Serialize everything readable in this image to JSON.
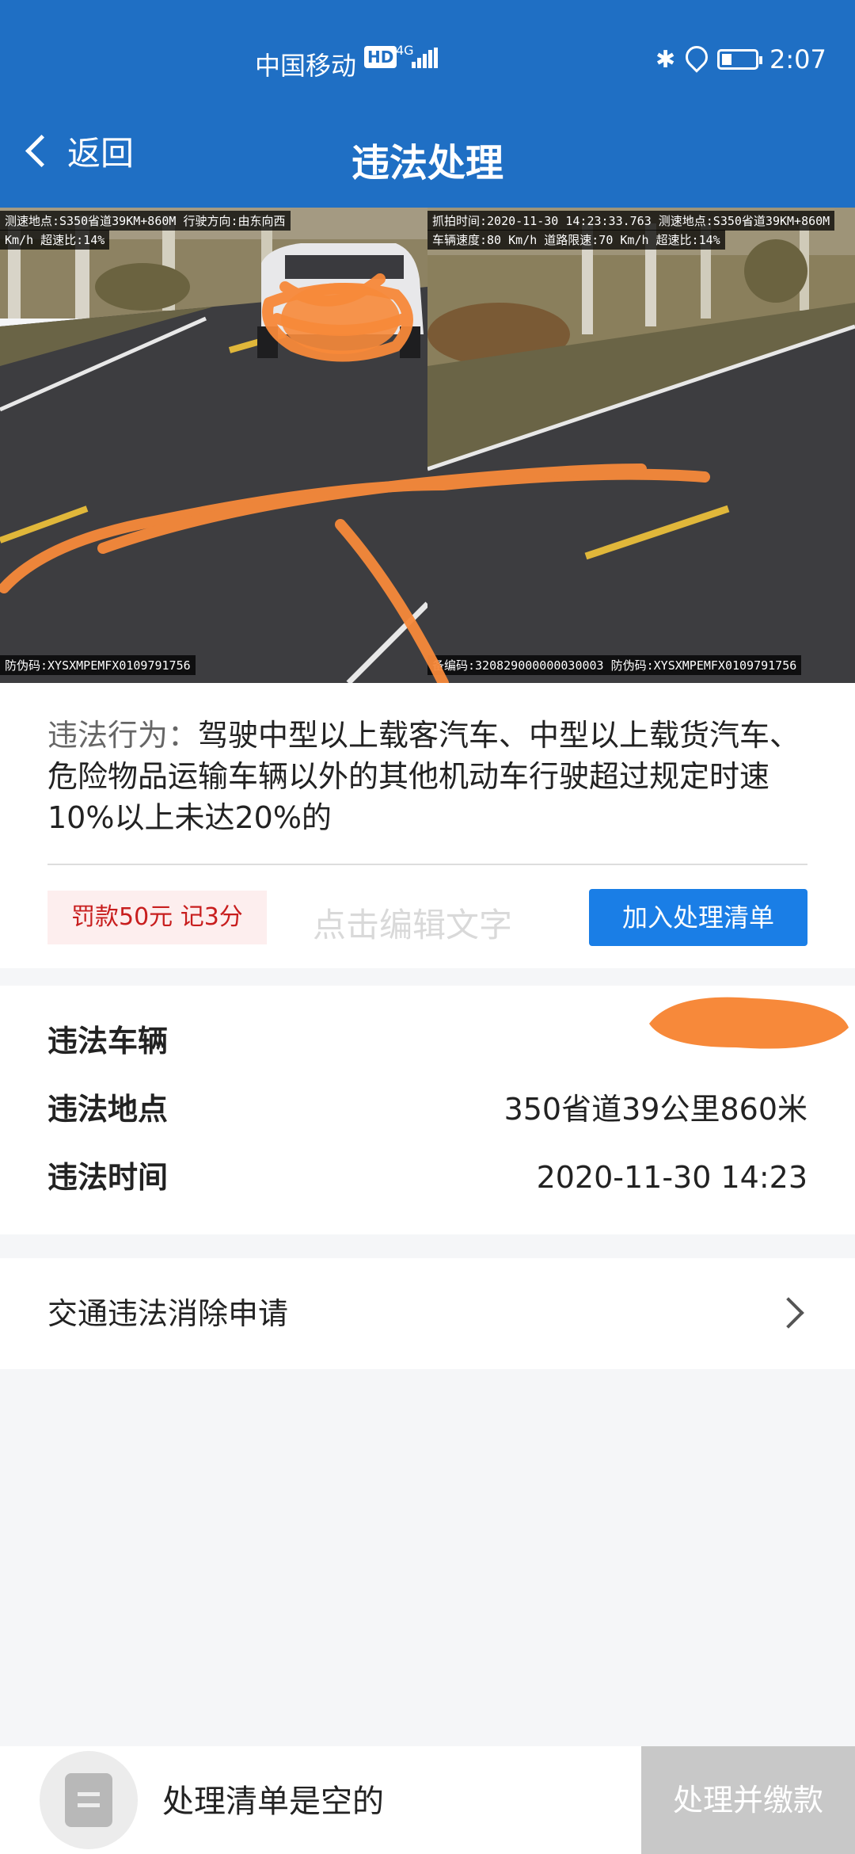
{
  "status_bar": {
    "carrier": "中国移动",
    "hd": "HD",
    "network": "4G",
    "time": "2:07"
  },
  "nav": {
    "back_label": "返回",
    "title": "违法处理"
  },
  "photos": {
    "left_caption_top_1": "测速地点:S350省道39KM+860M  行驶方向:由东向西",
    "left_caption_top_2": "Km/h  超速比:14%",
    "left_caption_bottom": "防伪码:XYSXMPEMFX0109791756",
    "right_caption_top_1": "抓拍时间:2020-11-30 14:23:33.763  测速地点:S350省道39KM+860M",
    "right_caption_top_2": "车辆速度:80 Km/h  道路限速:70 Km/h  超速比:14%",
    "right_caption_bottom": "备编码:320829000000030003  防伪码:XYSXMPEMFX0109791756"
  },
  "violation": {
    "label": "违法行为：",
    "text": "驾驶中型以上载客汽车、中型以上载货汽车、危险物品运输车辆以外的其他机动车行驶超过规定时速10%以上未达20%的",
    "penalty": "罚款50元 记3分",
    "edit_hint": "点击编辑文字",
    "add_button": "加入处理清单"
  },
  "details": {
    "vehicle_label": "违法车辆",
    "vehicle_value": "",
    "location_label": "违法地点",
    "location_value": "350省道39公里860米",
    "time_label": "违法时间",
    "time_value": "2020-11-30 14:23"
  },
  "appeal": {
    "label": "交通违法消除申请"
  },
  "bottom_bar": {
    "empty_text": "处理清单是空的",
    "pay_button": "处理并缴款"
  },
  "colors": {
    "header": "#1f6fc4",
    "primary_button": "#1a7ee6",
    "penalty_text": "#c81e1e",
    "scribble": "#f7893a"
  }
}
